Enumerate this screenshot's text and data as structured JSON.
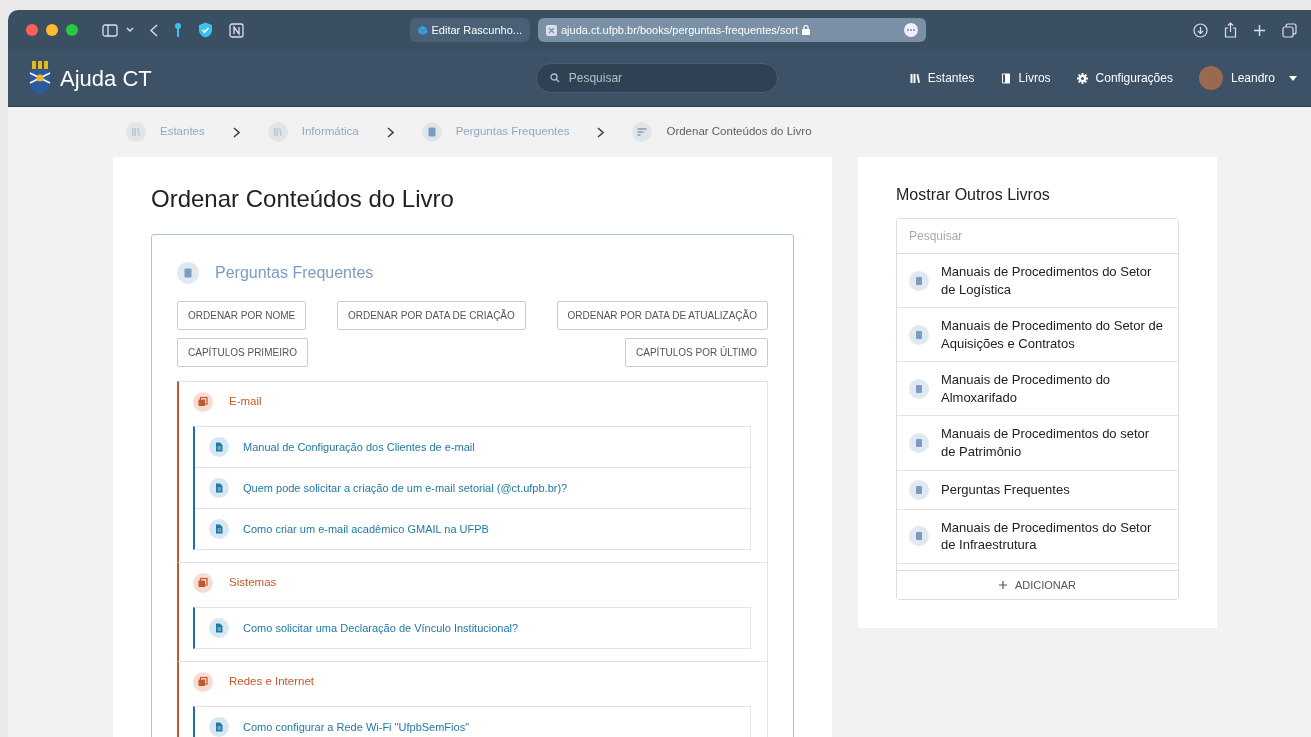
{
  "browser": {
    "tabs": [
      {
        "label": "Editar Rascunho...",
        "selected": false
      },
      {
        "label": "ajuda.ct.ufpb.br/books/perguntas-frequentes/sort",
        "selected": true
      }
    ]
  },
  "header": {
    "logo_text": "Ajuda CT",
    "search": {
      "placeholder": "Pesquisar"
    },
    "nav": [
      {
        "kind": "shelves",
        "label": "Estantes"
      },
      {
        "kind": "books",
        "label": "Livros"
      },
      {
        "kind": "settings",
        "label": "Configurações"
      }
    ],
    "user": "Leandro"
  },
  "breadcrumbs": [
    {
      "kind": "shelf",
      "label": "Estantes",
      "current": false
    },
    {
      "kind": "shelf",
      "label": "Informática",
      "current": false
    },
    {
      "kind": "book",
      "label": "Perguntas Frequentes",
      "current": false
    },
    {
      "kind": "sort",
      "label": "Ordenar Conteúdos do Livro",
      "current": true
    }
  ],
  "page_title": "Ordenar Conteúdos do Livro",
  "book": {
    "title": "Perguntas Frequentes",
    "sort_rows": [
      [
        "ORDENAR POR NOME",
        "ORDENAR POR DATA DE CRIAÇÃO",
        "ORDENAR POR DATA DE ATUALIZAÇÃO"
      ],
      [
        "CAPÍTULOS PRIMEIRO",
        "CAPÍTULOS POR ÚLTIMO"
      ]
    ],
    "chapters": [
      {
        "title": "E-mail",
        "pages": [
          "Manual de Configuração dos Clientes de e-mail",
          "Quem pode solicitar a criação de um e-mail setorial (@ct.ufpb.br)?",
          "Como criar um e-mail acadêmico GMAIL na UFPB"
        ]
      },
      {
        "title": "Sistemas",
        "pages": [
          "Como solicitar uma Declaração de Vínculo Institucional?"
        ]
      },
      {
        "title": "Redes e Internet",
        "pages": [
          "Como configurar a Rede Wi-Fi \"UfpbSemFios\""
        ]
      }
    ]
  },
  "sidebar": {
    "title": "Mostrar Outros Livros",
    "search": {
      "placeholder": "Pesquisar"
    },
    "books": [
      "Manuais de Procedimentos do Setor de Logística",
      "Manuais de Procedimento do Setor de Aquisições e Contratos",
      "Manuais de Procedimento do Almoxarifado",
      "Manuais de Procedimentos do setor de Patrimônio",
      "Perguntas Frequentes",
      "Manuais de Procedimentos do Setor de Infraestrutura"
    ],
    "add_label": "ADICIONAR"
  }
}
